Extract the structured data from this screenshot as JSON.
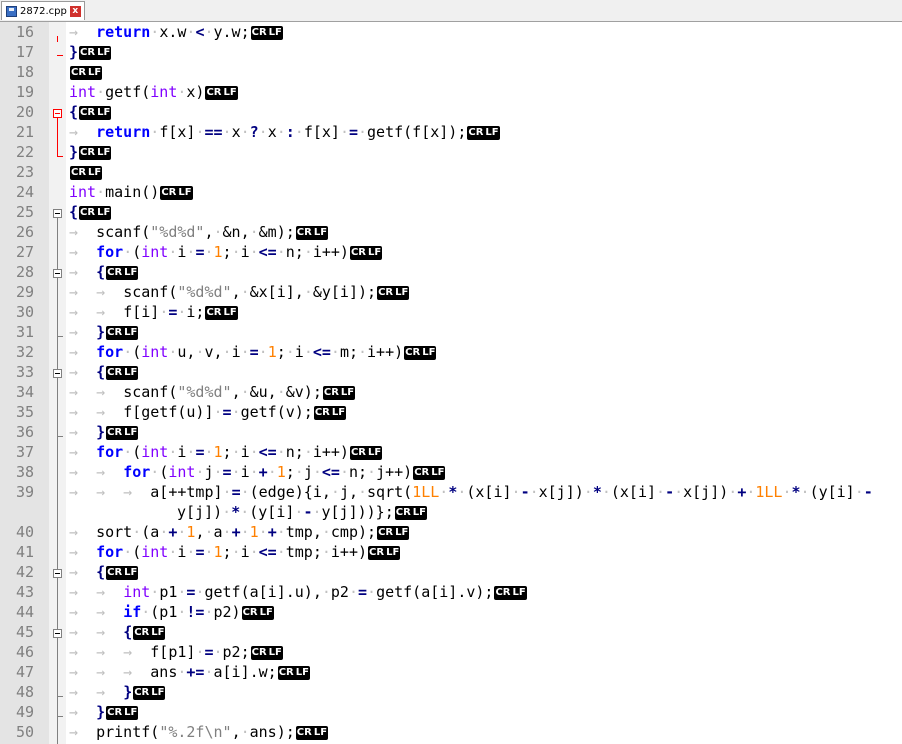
{
  "tab": {
    "title": "2872.cpp",
    "close_glyph": "x"
  },
  "line_numbers": [
    "16",
    "17",
    "18",
    "19",
    "20",
    "21",
    "22",
    "23",
    "24",
    "25",
    "26",
    "27",
    "28",
    "29",
    "30",
    "31",
    "32",
    "33",
    "34",
    "35",
    "36",
    "37",
    "38",
    "39",
    "",
    "40",
    "41",
    "42",
    "43",
    "44",
    "45",
    "46",
    "47",
    "48",
    "49",
    "50"
  ],
  "eol": {
    "cr": "CR",
    "lf": "LF"
  },
  "code": {
    "l16": [
      "return",
      "x.w",
      "<",
      "y.w;"
    ],
    "l17": "}",
    "l19": [
      "int",
      "getf(",
      "int",
      "x)"
    ],
    "l20": "{",
    "l21": [
      "return",
      "f[x]",
      "==",
      "x",
      "?",
      "x",
      ":",
      "f[x]",
      "=",
      "getf(f[x]);"
    ],
    "l22": "}",
    "l24": [
      "int",
      "main()"
    ],
    "l25": "{",
    "l26": [
      "scanf(",
      "\"%d%d\"",
      ",",
      "&n,",
      "&m);"
    ],
    "l27": [
      "for",
      "(",
      "int",
      "i",
      "=",
      "1",
      ";",
      "i",
      "<=",
      "n;",
      "i++)"
    ],
    "l28": "{",
    "l29": [
      "scanf(",
      "\"%d%d\"",
      ",",
      "&x[i],",
      "&y[i]);"
    ],
    "l30": [
      "f[i]",
      "=",
      "i;"
    ],
    "l31": "}",
    "l32": [
      "for",
      "(",
      "int",
      "u,",
      "v,",
      "i",
      "=",
      "1",
      ";",
      "i",
      "<=",
      "m;",
      "i++)"
    ],
    "l33": "{",
    "l34": [
      "scanf(",
      "\"%d%d\"",
      ",",
      "&u,",
      "&v);"
    ],
    "l35": [
      "f[getf(u)]",
      "=",
      "getf(v);"
    ],
    "l36": "}",
    "l37": [
      "for",
      "(",
      "int",
      "i",
      "=",
      "1",
      ";",
      "i",
      "<=",
      "n;",
      "i++)"
    ],
    "l38": [
      "for",
      "(",
      "int",
      "j",
      "=",
      "i",
      "+",
      "1",
      ";",
      "j",
      "<=",
      "n;",
      "j++)"
    ],
    "l39a": [
      "a[++tmp]",
      "=",
      "(edge){i,",
      "j,",
      "sqrt(",
      "1LL",
      "*",
      "(x[i]",
      "-",
      "x[j])",
      "*",
      "(x[i]",
      "-",
      "x[j])",
      "+",
      "1LL",
      "*",
      "(y[i]",
      "-"
    ],
    "l39b": [
      "y[j])",
      "*",
      "(y[i]",
      "-",
      "y[j]))};"
    ],
    "l40": [
      "sort",
      "(a",
      "+",
      "1",
      ",",
      "a",
      "+",
      "1",
      "+",
      "tmp,",
      "cmp);"
    ],
    "l41": [
      "for",
      "(",
      "int",
      "i",
      "=",
      "1",
      ";",
      "i",
      "<=",
      "tmp;",
      "i++)"
    ],
    "l42": "{",
    "l43": [
      "int",
      "p1",
      "=",
      "getf(a[i].u),",
      "p2",
      "=",
      "getf(a[i].v);"
    ],
    "l44": [
      "if",
      "(p1",
      "!=",
      "p2)"
    ],
    "l45": "{",
    "l46": [
      "f[p1]",
      "=",
      "p2;"
    ],
    "l47": [
      "ans",
      "+=",
      "a[i].w;"
    ],
    "l48": "}",
    "l49": "}",
    "l50": [
      "printf(",
      "\"%.2f\\n\"",
      ",",
      "ans);"
    ]
  },
  "colors": {
    "keyword": "#0000ff",
    "type": "#8000ff",
    "number": "#ff8000",
    "string": "#808080",
    "whitespace": "#c0c0c0"
  }
}
